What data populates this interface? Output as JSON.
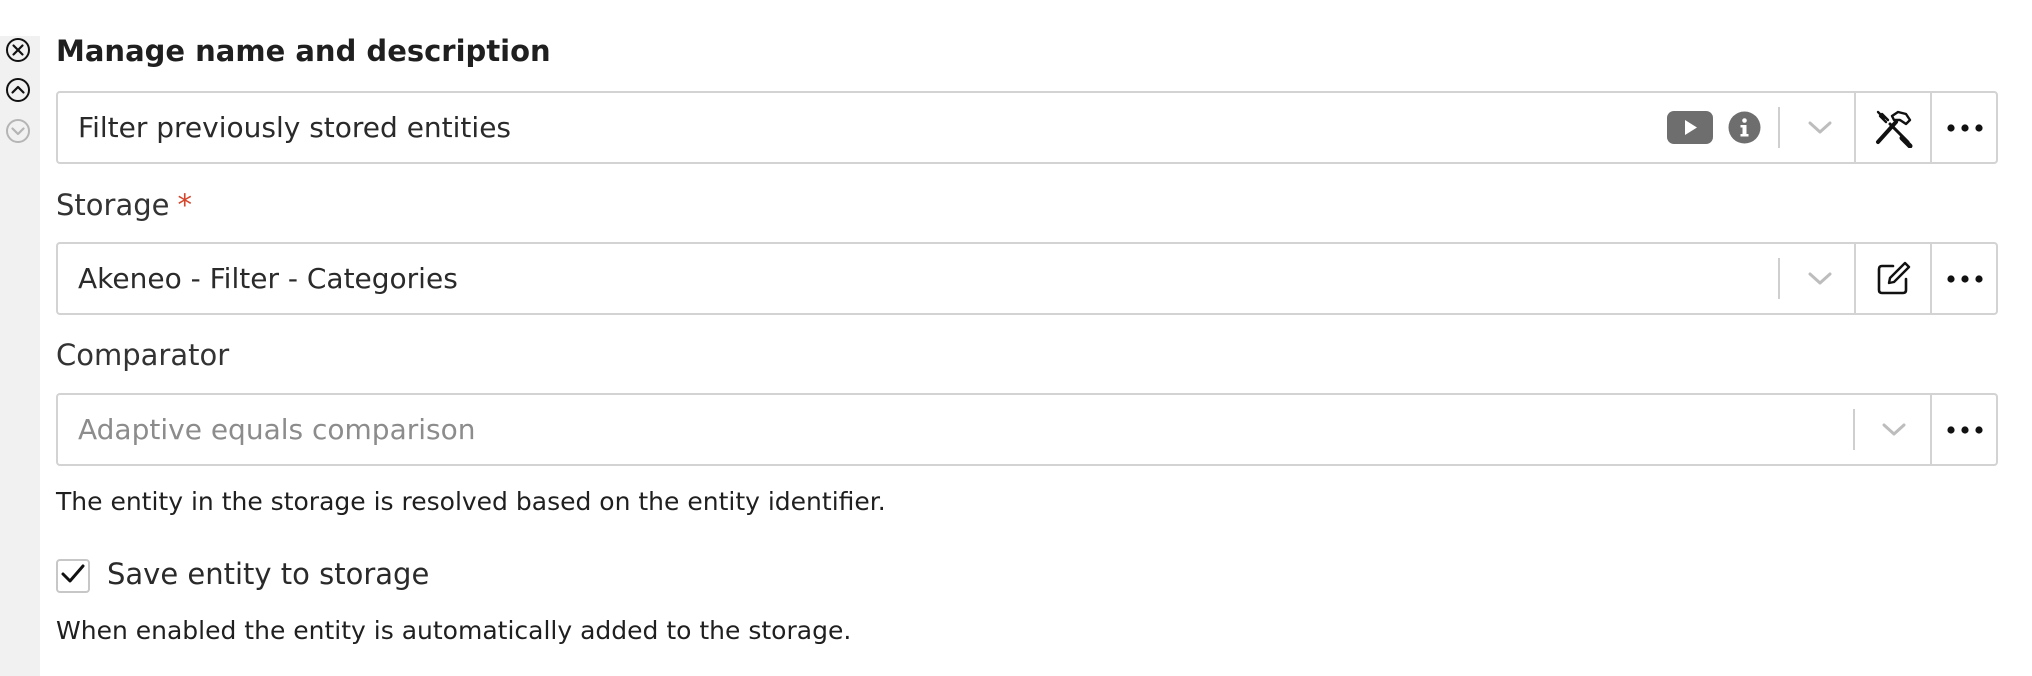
{
  "header": {
    "title": "Manage name and description"
  },
  "name_field": {
    "value": "Filter previously stored entities"
  },
  "storage": {
    "label": "Storage",
    "required_mark": "*",
    "value": "Akeneo - Filter - Categories"
  },
  "comparator": {
    "label": "Comparator",
    "placeholder": "Adaptive equals comparison",
    "help": "The entity in the storage is resolved based on the entity identifier."
  },
  "save_entity": {
    "label": "Save entity to storage",
    "checked": true,
    "help": "When enabled the entity is automatically added to the storage."
  },
  "icons": {
    "rail": [
      "close-circle-icon",
      "chevron-up-circle-icon",
      "chevron-down-circle-icon"
    ],
    "name_field": [
      "video-play-icon",
      "info-icon",
      "chevron-down-icon",
      "tools-icon",
      "more-icon"
    ],
    "storage": [
      "chevron-down-icon",
      "edit-icon",
      "more-icon"
    ],
    "comparator": [
      "chevron-down-icon",
      "more-icon"
    ]
  },
  "colors": {
    "required": "#d4452b",
    "border": "#d3d3d3",
    "rail_background": "#f1f1f1",
    "icon_gray": "#6e6e6e"
  }
}
